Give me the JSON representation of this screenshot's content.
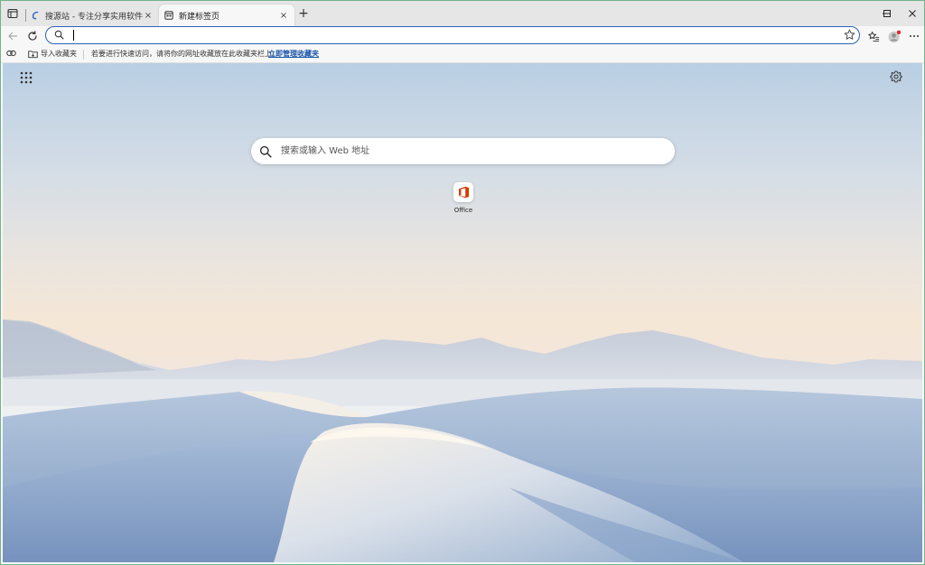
{
  "tabs": [
    {
      "title": "搜源站 - 专注分享实用软件与免费",
      "close": "×",
      "active": false
    },
    {
      "title": "新建标签页",
      "close": "×",
      "active": true
    }
  ],
  "new_tab": "+",
  "window_controls": {
    "minimize": "—",
    "maximize": "☐",
    "close": "✕"
  },
  "address_bar": {
    "value": "",
    "placeholder": ""
  },
  "favorites_bar": {
    "import_label": "导入收藏夹",
    "hint": "若要进行快速访问，请将你的网址收藏放在此收藏夹栏上。",
    "manage_link": "立即管理收藏夹"
  },
  "page": {
    "search_placeholder": "搜索或输入 Web 地址",
    "quick_links": [
      {
        "label": "Office",
        "icon": "office-icon"
      }
    ]
  },
  "colors": {
    "accent": "#2b62b8",
    "office": "#d83b01"
  }
}
